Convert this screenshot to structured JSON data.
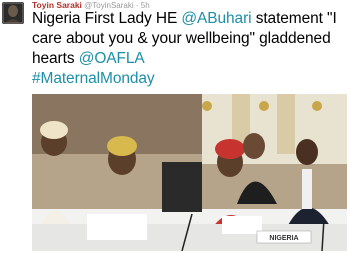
{
  "user": {
    "name": "Toyin Saraki",
    "handle": "@ToyinSaraki",
    "time": "5h"
  },
  "tweet": {
    "part1": "Nigeria First Lady HE ",
    "mention1": "@ABuhari",
    "part2": " statement \"I care about you & your wellbeing\" gladdened hearts ",
    "mention2": "@OAFLA",
    "hashtag": "#MaternalMonday"
  },
  "photo": {
    "placard_text": "NIGERIA"
  },
  "colors": {
    "name": "#b0302a",
    "link": "#1e8fa8",
    "meta": "#9a9a9a"
  },
  "icons": {
    "avatar": "profile-photo"
  }
}
